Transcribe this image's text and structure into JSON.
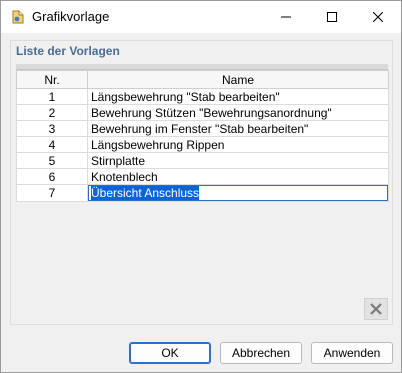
{
  "window": {
    "title": "Grafikvorlage",
    "icon": "template-app-icon"
  },
  "group": {
    "title": "Liste der Vorlagen"
  },
  "table": {
    "columns": [
      "Nr.",
      "Name"
    ],
    "rows": [
      {
        "nr": "1",
        "name": "Längsbewehrung \"Stab bearbeiten\""
      },
      {
        "nr": "2",
        "name": "Bewehrung Stützen \"Bewehrungsanordnung\""
      },
      {
        "nr": "3",
        "name": "Bewehrung im Fenster \"Stab bearbeiten\""
      },
      {
        "nr": "4",
        "name": "Längsbewehrung Rippen"
      },
      {
        "nr": "5",
        "name": "Stirnplatte"
      },
      {
        "nr": "6",
        "name": "Knotenblech"
      },
      {
        "nr": "7",
        "name": "Übersicht Anschluss"
      }
    ],
    "editing_row": 7
  },
  "buttons": {
    "ok": "OK",
    "cancel": "Abbrechen",
    "apply": "Anwenden"
  },
  "colors": {
    "group_title": "#4a6c91",
    "selection": "#0a64d6",
    "focus_border": "#2c6fcc"
  }
}
